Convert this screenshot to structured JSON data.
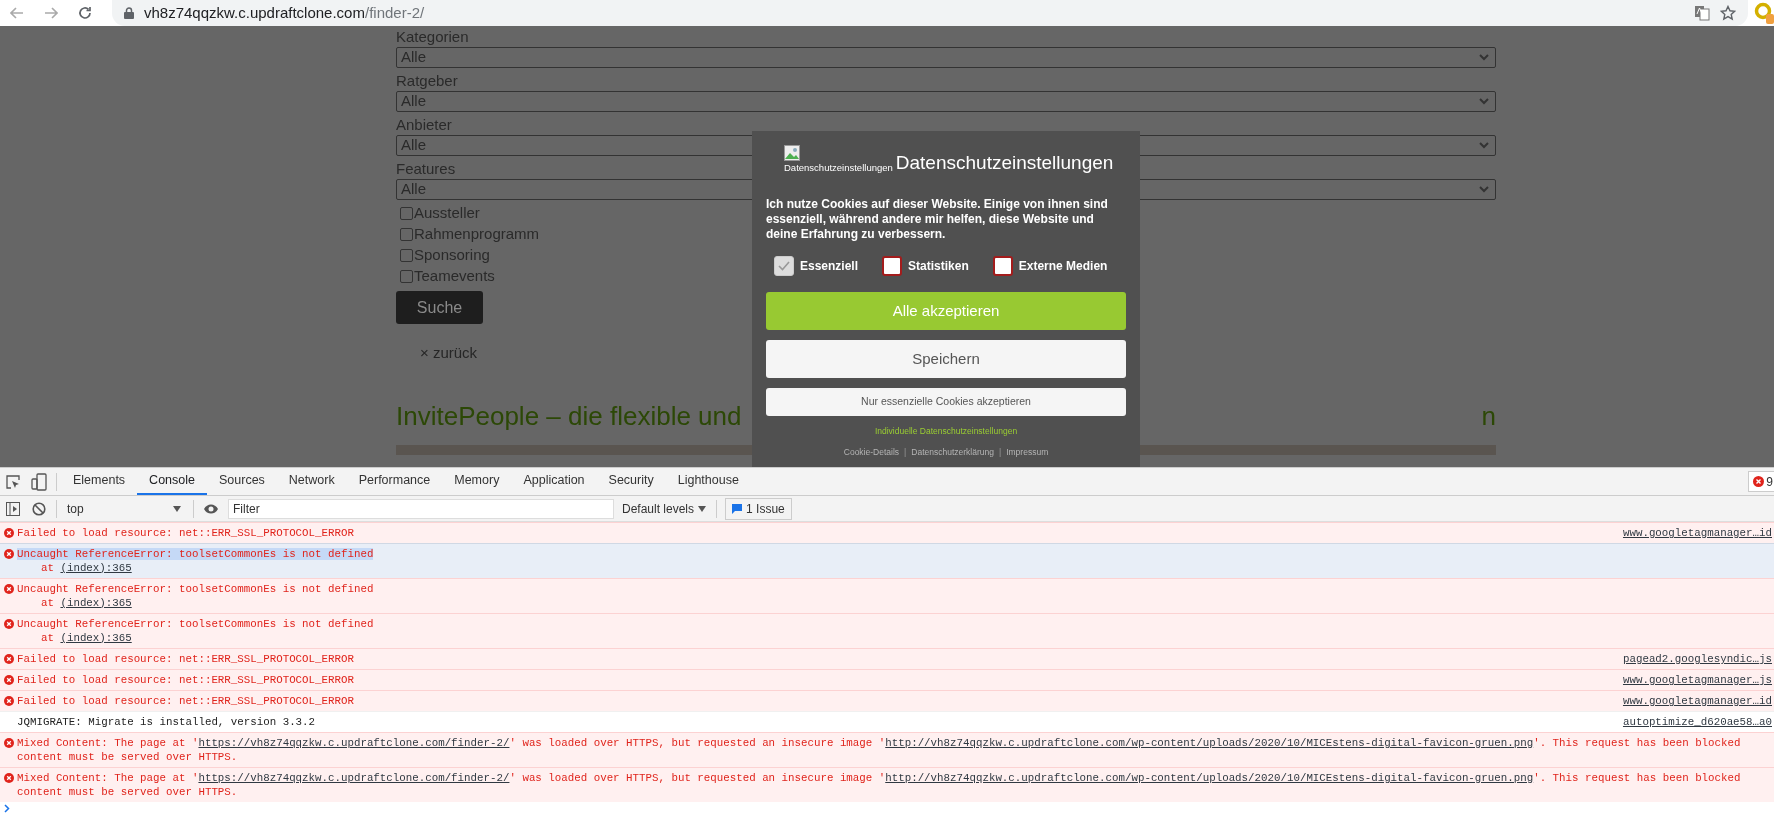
{
  "browser": {
    "url_host": "vh8z74qqzkw.c.updraftclone.com",
    "url_path": "/finder-2/"
  },
  "page": {
    "fields": [
      {
        "label": "Kategorien",
        "value": "Alle"
      },
      {
        "label": "Ratgeber",
        "value": "Alle"
      },
      {
        "label": "Anbieter",
        "value": "Alle"
      },
      {
        "label": "Features",
        "value": "Alle"
      }
    ],
    "checkboxes": [
      {
        "label": "Aussteller",
        "checked": false
      },
      {
        "label": "Rahmenprogramm",
        "checked": false
      },
      {
        "label": "Sponsoring",
        "checked": false
      },
      {
        "label": "Teamevents",
        "checked": false
      }
    ],
    "search_button": "Suche",
    "back_link": "× zurück",
    "heading_visible_start": "InvitePeople – die flexible und",
    "heading_visible_end": "n"
  },
  "cookie_dialog": {
    "image_alt": "Datenschutzeinstellungen",
    "title": "Datenschutzeinstellungen",
    "text": "Ich nutze Cookies auf dieser Website. Einige von ihnen sind essenziell, während andere mir helfen, diese Website und deine Erfahrung zu verbessern.",
    "options": [
      {
        "label": "Essenziell",
        "checked": true,
        "disabled": true
      },
      {
        "label": "Statistiken",
        "checked": false,
        "disabled": false
      },
      {
        "label": "Externe Medien",
        "checked": false,
        "disabled": false
      }
    ],
    "buttons": [
      {
        "kind": "primary",
        "label": "Alle akzeptieren"
      },
      {
        "kind": "secondary",
        "label": "Speichern"
      },
      {
        "kind": "small",
        "label": "Nur essenzielle Cookies akzeptieren"
      }
    ],
    "settings_link": "Individuelle Datenschutzeinstellungen",
    "footer": [
      {
        "kind": "link",
        "text": "Cookie-Details"
      },
      {
        "kind": "separator",
        "text": "|"
      },
      {
        "kind": "link",
        "text": "Datenschutzerklärung"
      },
      {
        "kind": "separator",
        "text": "|"
      },
      {
        "kind": "link",
        "text": "Impressum"
      }
    ]
  },
  "devtools": {
    "tabs": [
      {
        "label": "Elements",
        "selected": false
      },
      {
        "label": "Console",
        "selected": true
      },
      {
        "label": "Sources",
        "selected": false
      },
      {
        "label": "Network",
        "selected": false
      },
      {
        "label": "Performance",
        "selected": false
      },
      {
        "label": "Memory",
        "selected": false
      },
      {
        "label": "Application",
        "selected": false
      },
      {
        "label": "Security",
        "selected": false
      },
      {
        "label": "Lighthouse",
        "selected": false
      }
    ],
    "error_count": "9",
    "context": "top",
    "filter_placeholder": "Filter",
    "levels": "Default levels",
    "issues": "1 Issue",
    "messages": [
      {
        "kind": "error",
        "selected": false,
        "segments": [
          {
            "kind": "text",
            "text": "Failed to load resource: net::ERR_SSL_PROTOCOL_ERROR"
          }
        ],
        "source": "www.googletagmanager…id"
      },
      {
        "kind": "error",
        "selected": true,
        "segments": [
          {
            "kind": "text",
            "text": "Uncaught ReferenceError: toolsetCommonEs is not defined"
          }
        ],
        "stack_prefix": "at",
        "stack_link": "(index):365"
      },
      {
        "kind": "error",
        "selected": false,
        "segments": [
          {
            "kind": "text",
            "text": "Uncaught ReferenceError: toolsetCommonEs is not defined"
          }
        ],
        "stack_prefix": "at",
        "stack_link": "(index):365"
      },
      {
        "kind": "error",
        "selected": false,
        "segments": [
          {
            "kind": "text",
            "text": "Uncaught ReferenceError: toolsetCommonEs is not defined"
          }
        ],
        "stack_prefix": "at",
        "stack_link": "(index):365"
      },
      {
        "kind": "error",
        "selected": false,
        "segments": [
          {
            "kind": "text",
            "text": "Failed to load resource: net::ERR_SSL_PROTOCOL_ERROR"
          }
        ],
        "source": "pagead2.googlesyndic…js"
      },
      {
        "kind": "error",
        "selected": false,
        "segments": [
          {
            "kind": "text",
            "text": "Failed to load resource: net::ERR_SSL_PROTOCOL_ERROR"
          }
        ],
        "source": "www.googletagmanager…js"
      },
      {
        "kind": "error",
        "selected": false,
        "segments": [
          {
            "kind": "text",
            "text": "Failed to load resource: net::ERR_SSL_PROTOCOL_ERROR"
          }
        ],
        "source": "www.googletagmanager…id"
      },
      {
        "kind": "log",
        "selected": false,
        "segments": [
          {
            "kind": "text",
            "text": "JQMIGRATE: Migrate is installed, version 3.3.2"
          }
        ],
        "source": "autoptimize_d620ae58…a0"
      },
      {
        "kind": "error",
        "selected": false,
        "segments": [
          {
            "kind": "text",
            "text": "Mixed Content: The page at '"
          },
          {
            "kind": "link",
            "text": "https://vh8z74qqzkw.c.updraftclone.com/finder-2/"
          },
          {
            "kind": "text",
            "text": "' was loaded over HTTPS, but requested an insecure image '"
          },
          {
            "kind": "link",
            "text": "http://vh8z74qqzkw.c.updraftclone.com/wp-content/uploads/2020/10/MICEstens-digital-favicon-gruen.png"
          },
          {
            "kind": "text",
            "text": "'. This request has been blocked"
          }
        ],
        "line_2": "content must be served over HTTPS."
      },
      {
        "kind": "error",
        "selected": false,
        "segments": [
          {
            "kind": "text",
            "text": "Mixed Content: The page at '"
          },
          {
            "kind": "link",
            "text": "https://vh8z74qqzkw.c.updraftclone.com/finder-2/"
          },
          {
            "kind": "text",
            "text": "' was loaded over HTTPS, but requested an insecure image '"
          },
          {
            "kind": "link",
            "text": "http://vh8z74qqzkw.c.updraftclone.com/wp-content/uploads/2020/10/MICEstens-digital-favicon-gruen.png"
          },
          {
            "kind": "text",
            "text": "'. This request has been blocked"
          }
        ],
        "line_2": "content must be served over HTTPS."
      }
    ]
  }
}
